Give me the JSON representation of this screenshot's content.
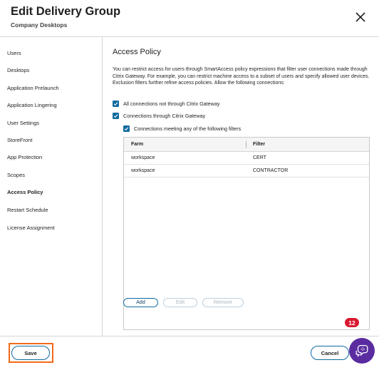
{
  "header": {
    "title": "Edit Delivery Group",
    "subtitle": "Company Desktops",
    "close_icon": "close-icon"
  },
  "sidebar": {
    "items": [
      {
        "label": "Users"
      },
      {
        "label": "Desktops"
      },
      {
        "label": "Application Prelaunch"
      },
      {
        "label": "Application Lingering"
      },
      {
        "label": "User Settings"
      },
      {
        "label": "StoreFront"
      },
      {
        "label": "App Protection"
      },
      {
        "label": "Scopes"
      },
      {
        "label": "Access Policy",
        "active": true
      },
      {
        "label": "Restart Schedule"
      },
      {
        "label": "License Assignment"
      }
    ]
  },
  "main": {
    "section_title": "Access Policy",
    "description": "You can restrict access for users through SmartAccess policy expressions that filter user connections made through Citrix Gateway. For example, you can restrict machine access to a subset of users and specify allowed user devices. Exclusion filters further refine access policies. Allow the following connections:",
    "checkboxes": {
      "not_through_gateway": {
        "label": "All connections not through Citrix Gateway",
        "checked": true
      },
      "through_gateway": {
        "label": "Connections through Citrix Gateway",
        "checked": true
      },
      "meeting_filters": {
        "label": "Connections meeting any of the following filters",
        "checked": true
      }
    },
    "table": {
      "columns": [
        "Farm",
        "Filter"
      ],
      "rows": [
        {
          "farm": "workspace",
          "filter": "CERT"
        },
        {
          "farm": "workspace",
          "filter": "CONTRACTOR"
        }
      ]
    },
    "buttons": {
      "add": "Add",
      "edit": "Edit",
      "remove": "Remove"
    }
  },
  "footer": {
    "save": "Save",
    "cancel": "Cancel"
  },
  "assistant": {
    "badge_count": "12",
    "icon": "assistant-icon"
  },
  "colors": {
    "accent": "#0f6a9e",
    "highlight": "#f26a1b",
    "badge": "#d8182f",
    "assistant": "#5a2ca0"
  }
}
